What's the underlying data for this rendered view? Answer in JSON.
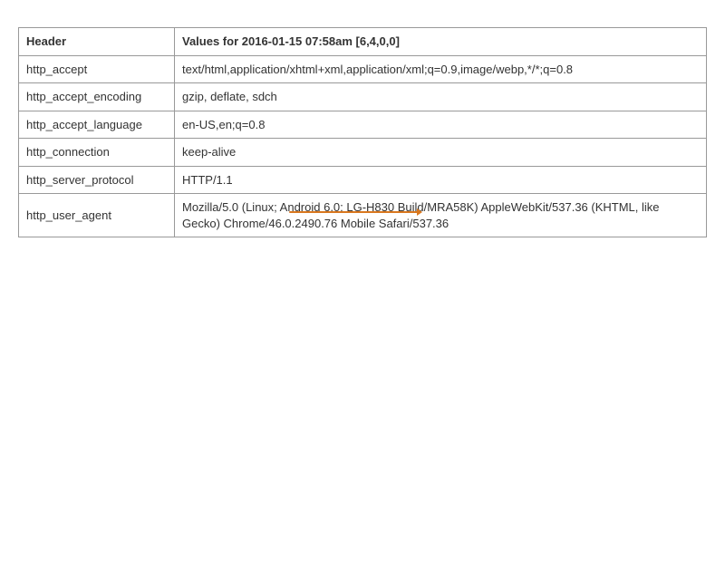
{
  "table": {
    "col1_header": "Header",
    "col2_header": "Values for 2016-01-15 07:58am [6,4,0,0]",
    "rows": [
      {
        "name": "http_accept",
        "value": "text/html,application/xhtml+xml,application/xml;q=0.9,image/webp,*/*;q=0.8"
      },
      {
        "name": "http_accept_encoding",
        "value": "gzip, deflate, sdch"
      },
      {
        "name": "http_accept_language",
        "value": "en-US,en;q=0.8"
      },
      {
        "name": "http_connection",
        "value": "keep-alive"
      },
      {
        "name": "http_server_protocol",
        "value": "HTTP/1.1"
      },
      {
        "name": "http_user_agent",
        "value": "Mozilla/5.0 (Linux; Android 6.0; LG-H830 Build/MRA58K) AppleWebKit/537.36 (KHTML, like Gecko) Chrome/46.0.2490.76 Mobile Safari/537.36"
      }
    ]
  }
}
